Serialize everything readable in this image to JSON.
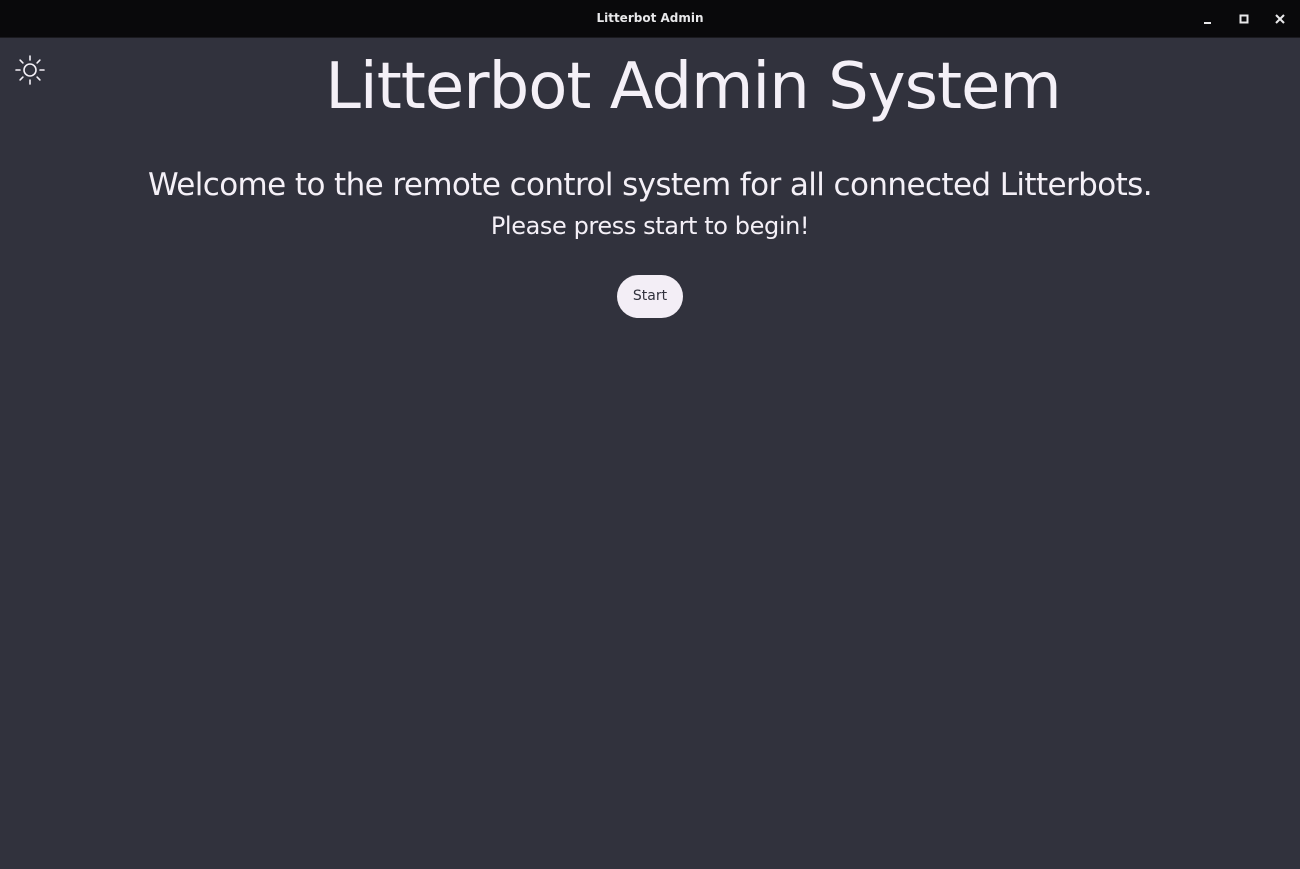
{
  "window": {
    "title": "Litterbot Admin",
    "controls": {
      "minimize_icon": "minimize-icon",
      "maximize_icon": "maximize-icon",
      "close_icon": "close-icon"
    }
  },
  "theme_toggle": {
    "icon": "sun-icon"
  },
  "main": {
    "title": "Litterbot Admin System",
    "welcome": "Welcome to the remote control system for all connected Litterbots.",
    "instruction": "Please press start to begin!",
    "start_label": "Start"
  },
  "colors": {
    "background": "#31323d",
    "titlebar": "#09090b",
    "text": "#f4f0f7",
    "button_bg": "#f3eef6",
    "button_text": "#31323d"
  }
}
